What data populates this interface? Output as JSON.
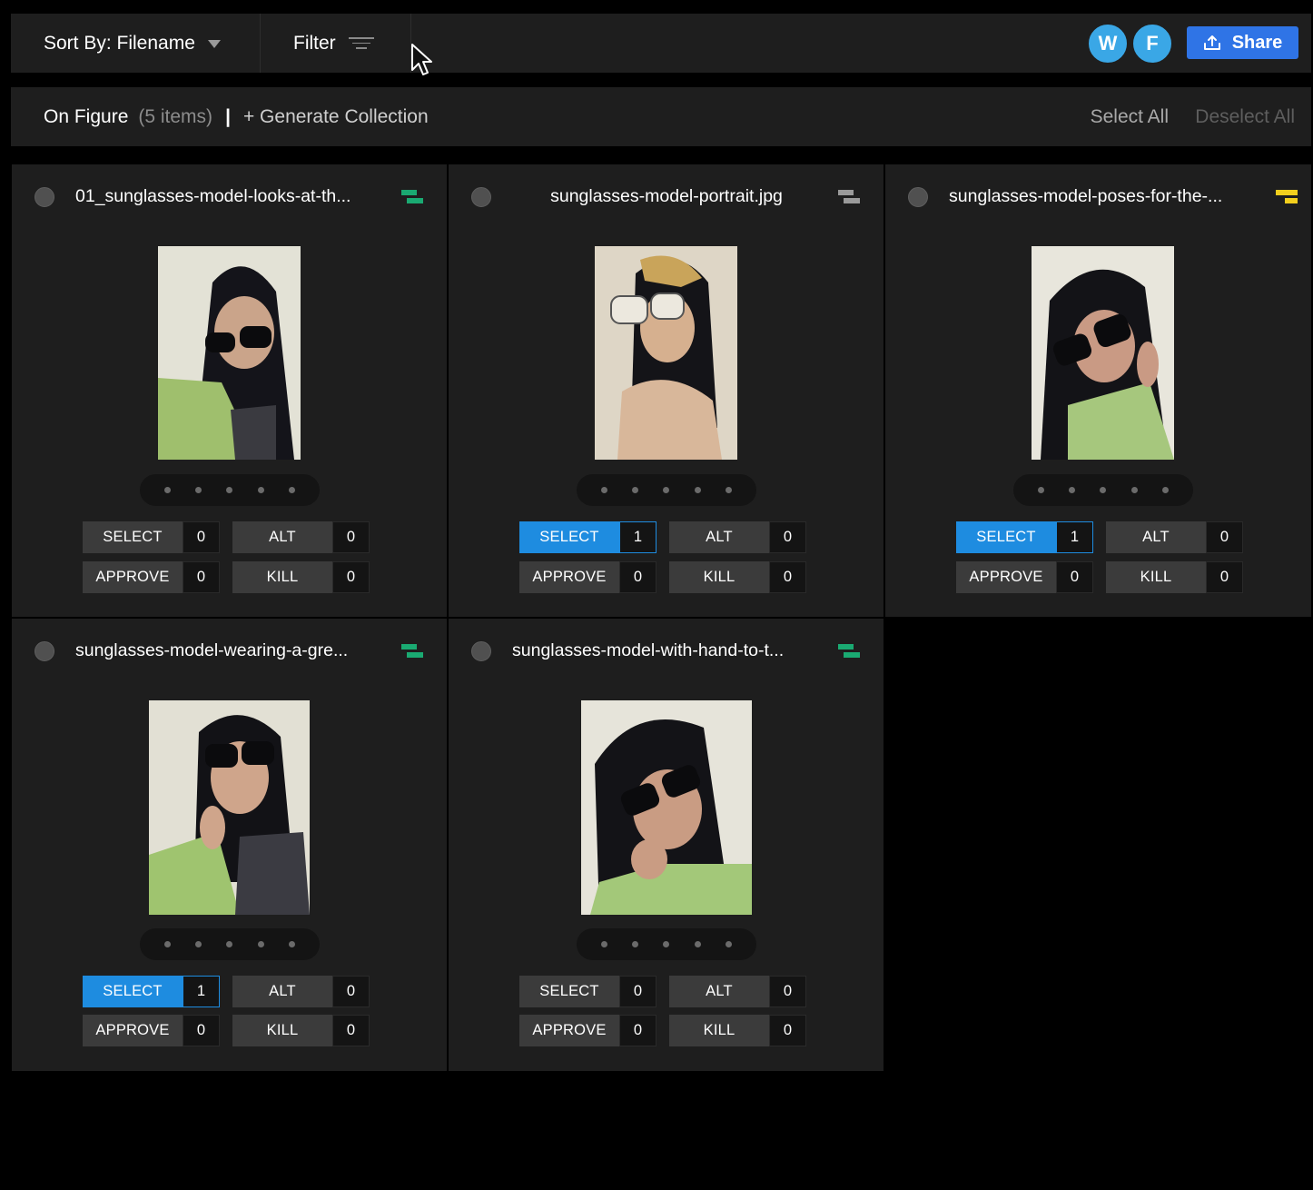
{
  "toolbar": {
    "sort_label": "Sort By: Filename",
    "filter_label": "Filter",
    "avatars": [
      "W",
      "F"
    ],
    "share_label": "Share"
  },
  "collection": {
    "title": "On Figure",
    "count": "(5 items)",
    "separator": "|",
    "generate": "+ Generate Collection",
    "select_all": "Select All",
    "deselect_all": "Deselect All"
  },
  "labels": {
    "select": "SELECT",
    "alt": "ALT",
    "approve": "APPROVE",
    "kill": "KILL"
  },
  "colors": {
    "status_green": "#1aaa72",
    "status_gray": "#9a9a9a",
    "status_yellow": "#f3cf1d",
    "accent_blue": "#1e8ce0",
    "share_blue": "#2f74e6"
  },
  "cards": [
    {
      "filename": "01_sunglasses-model-looks-at-th...",
      "status": "green",
      "counts": {
        "select": "0",
        "alt": "0",
        "approve": "0",
        "kill": "0"
      },
      "selected": false
    },
    {
      "filename": "sunglasses-model-portrait.jpg",
      "status": "gray",
      "counts": {
        "select": "1",
        "alt": "0",
        "approve": "0",
        "kill": "0"
      },
      "selected": true
    },
    {
      "filename": "sunglasses-model-poses-for-the-...",
      "status": "yellow",
      "counts": {
        "select": "1",
        "alt": "0",
        "approve": "0",
        "kill": "0"
      },
      "selected": true
    },
    {
      "filename": "sunglasses-model-wearing-a-gre...",
      "status": "green",
      "counts": {
        "select": "1",
        "alt": "0",
        "approve": "0",
        "kill": "0"
      },
      "selected": true
    },
    {
      "filename": "sunglasses-model-with-hand-to-t...",
      "status": "green",
      "counts": {
        "select": "0",
        "alt": "0",
        "approve": "0",
        "kill": "0"
      },
      "selected": false
    }
  ]
}
